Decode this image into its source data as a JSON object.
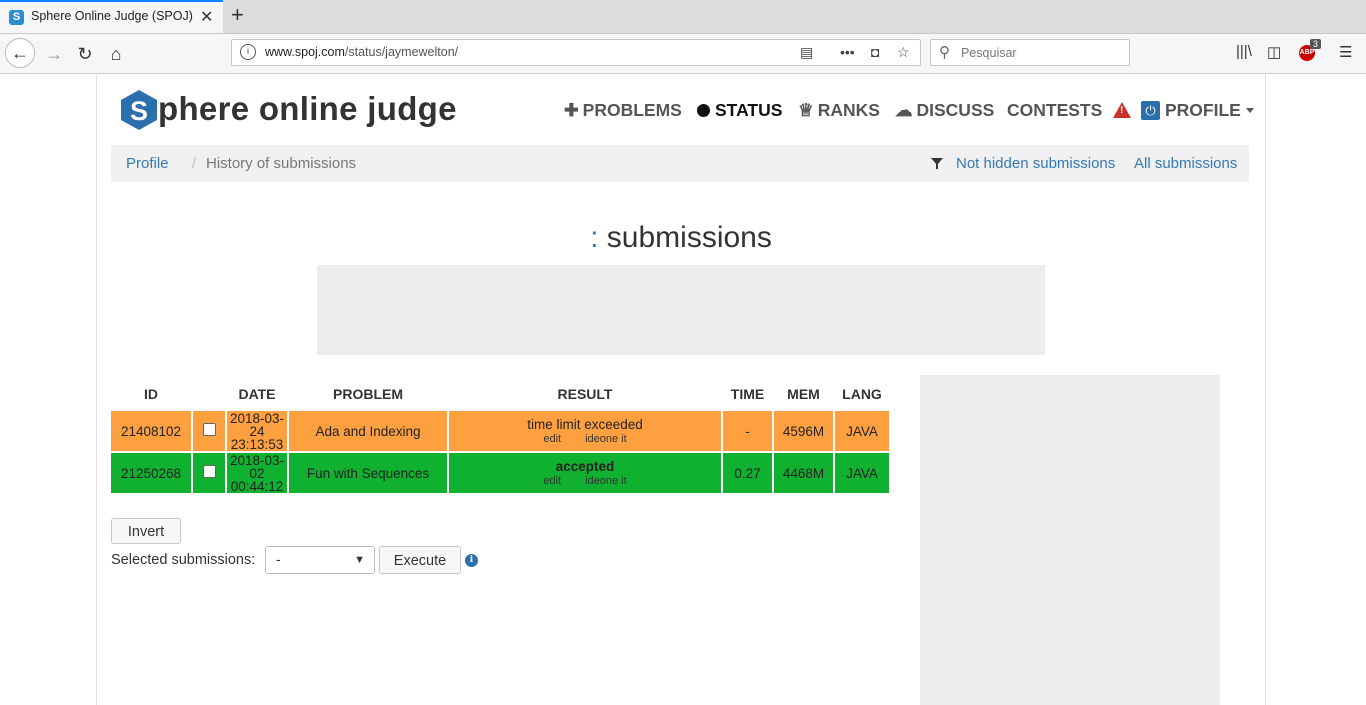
{
  "browser": {
    "tab_title": "Sphere Online Judge (SPOJ) - S",
    "url_host": "www.spoj.com",
    "url_path": "/status/jaymewelton/",
    "search_placeholder": "Pesquisar",
    "adblock_count": "3",
    "adblock_label": "ABP"
  },
  "site": {
    "logo_letter": "S",
    "logo_text": "phere online judge",
    "nav": {
      "problems": "PROBLEMS",
      "status": "STATUS",
      "ranks": "RANKS",
      "discuss": "DISCUSS",
      "contests": "CONTESTS",
      "profile": "PROFILE"
    }
  },
  "breadcrumb": {
    "profile": "Profile",
    "separator": "/",
    "current": "History of submissions",
    "filter_not_hidden": "Not hidden submissions",
    "filter_all": "All submissions"
  },
  "heading": {
    "colon": ":",
    "text": " submissions"
  },
  "table": {
    "headers": {
      "id": "ID",
      "date": "DATE",
      "problem": "PROBLEM",
      "result": "RESULT",
      "time": "TIME",
      "mem": "MEM",
      "lang": "LANG"
    },
    "rows": [
      {
        "id": "21408102",
        "date_day": "2018-03-24",
        "date_time": "23:13:53",
        "problem": "Ada and Indexing",
        "result": "time limit exceeded",
        "edit": "edit",
        "ideone": "ideone it",
        "time": "-",
        "mem": "4596M",
        "lang": "JAVA"
      },
      {
        "id": "21250268",
        "date_day": "2018-03-02",
        "date_time": "00:44:12",
        "problem": "Fun with Sequences",
        "result": "accepted",
        "edit": "edit",
        "ideone": "ideone it",
        "time": "0.27",
        "mem": "4468M",
        "lang": "JAVA"
      }
    ]
  },
  "controls": {
    "invert": "Invert",
    "selected_label": "Selected submissions:",
    "select_value": "-",
    "execute": "Execute"
  },
  "colors": {
    "tle": "#ffa040",
    "accepted": "#10b030",
    "link": "#337ab7"
  }
}
